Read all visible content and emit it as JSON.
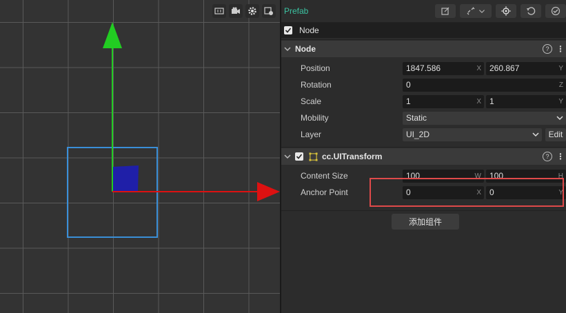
{
  "scene_toolbar": {
    "icons": [
      "frame-icon",
      "camera-icon",
      "gear-icon",
      "scene-settings-icon"
    ]
  },
  "header": {
    "prefab_label": "Prefab"
  },
  "node": {
    "name": "Node",
    "active": true
  },
  "node_section": {
    "title": "Node",
    "help": "?",
    "position": {
      "label": "Position",
      "x": "1847.586",
      "y": "260.867",
      "x_axis": "X",
      "y_axis": "Y"
    },
    "rotation": {
      "label": "Rotation",
      "z": "0",
      "z_axis": "Z"
    },
    "scale": {
      "label": "Scale",
      "x": "1",
      "y": "1",
      "x_axis": "X",
      "y_axis": "Y"
    },
    "mobility": {
      "label": "Mobility",
      "value": "Static"
    },
    "layer": {
      "label": "Layer",
      "value": "UI_2D",
      "edit": "Edit"
    }
  },
  "uitransform_section": {
    "title": "cc.UITransform",
    "help": "?",
    "enabled": true,
    "content_size": {
      "label": "Content Size",
      "w": "100",
      "h": "100",
      "w_axis": "W",
      "h_axis": "H"
    },
    "anchor_point": {
      "label": "Anchor Point",
      "x": "0",
      "y": "0",
      "x_axis": "X",
      "y_axis": "Y"
    }
  },
  "add_component_label": "添加组件",
  "colors": {
    "accent_prefab": "#3cc3a2",
    "highlight_red": "#e04a4a",
    "gizmo_green": "#22cc22",
    "gizmo_red": "#dd1111",
    "selection_blue": "#3a8fd8",
    "sprite_blue": "#1f1fa8"
  }
}
